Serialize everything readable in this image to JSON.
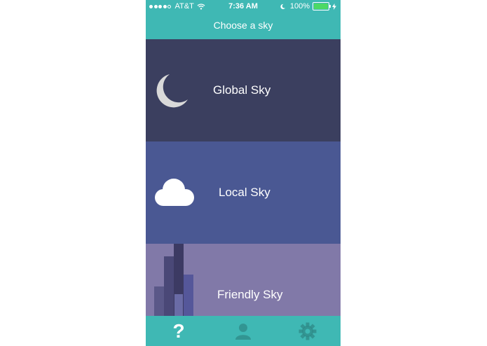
{
  "status_bar": {
    "carrier": "AT&T",
    "time": "7:36 AM",
    "battery_percent": "100%",
    "signal_bars": 4,
    "signal_total": 5,
    "battery_color": "#4cd964"
  },
  "header": {
    "title": "Choose a sky",
    "background": "#3fb8b4"
  },
  "skies": [
    {
      "label": "Global Sky",
      "icon": "moon-icon",
      "color": "#3b3f5f"
    },
    {
      "label": "Local Sky",
      "icon": "cloud-icon",
      "color": "#4a5893"
    },
    {
      "label": "Friendly Sky",
      "icon": "skyline-icon",
      "color": "#8179a8"
    }
  ],
  "tab_bar": {
    "background": "#3fb8b4",
    "tabs": [
      {
        "name": "help",
        "icon": "question-mark-icon",
        "glyph": "?",
        "active": true
      },
      {
        "name": "profile",
        "icon": "user-icon",
        "active": false
      },
      {
        "name": "settings",
        "icon": "gear-icon",
        "active": false
      }
    ]
  }
}
